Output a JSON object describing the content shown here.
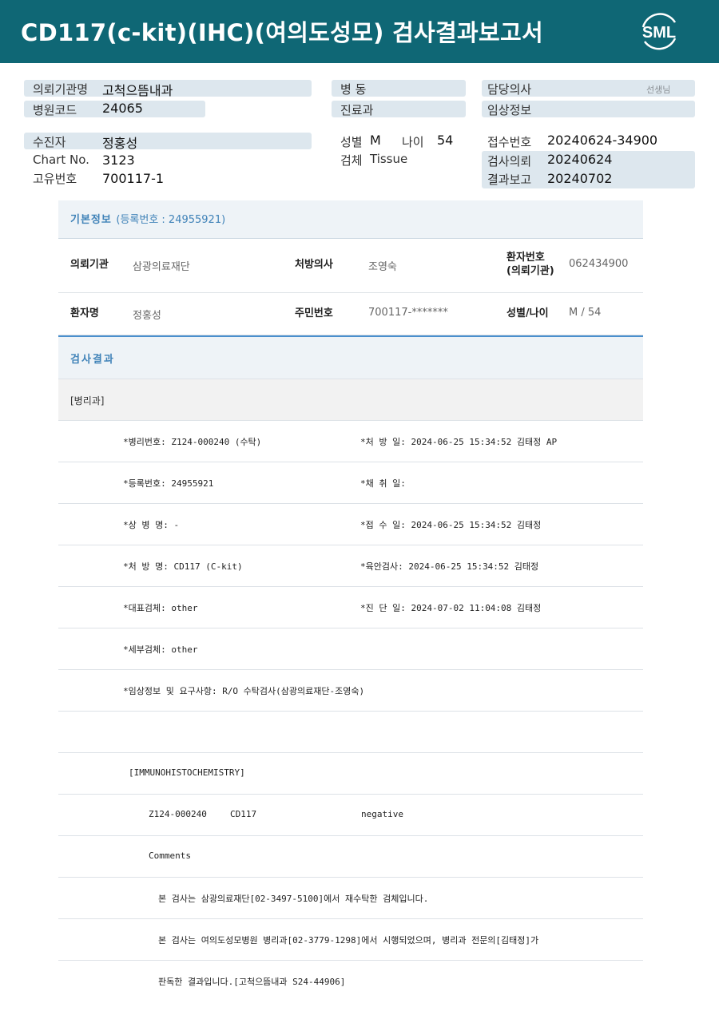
{
  "header": {
    "title": "CD117(c-kit)(IHC)(여의도성모) 검사결과보고서",
    "logo_text": "SML",
    "bg_color": "#0f6775"
  },
  "summary": {
    "institution_label": "의뢰기관명",
    "institution": "고척으뜸내과",
    "hospital_code_label": "병원코드",
    "hospital_code": "24065",
    "patient_label": "수진자",
    "patient": "정홍성",
    "chart_label": "Chart No.",
    "chart": "3123",
    "unique_label": "고유번호",
    "unique": "700117-1",
    "ward_label": "병 동",
    "dept_label": "진료과",
    "sex_label": "성별",
    "sex": "M",
    "age_label": "나이",
    "age": "54",
    "specimen_label": "검체",
    "specimen": "Tissue",
    "doctor_label": "담당의사",
    "doctor_suffix": "선생님",
    "clinical_label": "임상정보",
    "reception_label": "접수번호",
    "reception": "20240624-34900",
    "request_label": "검사의뢰",
    "request": "20240624",
    "report_label": "결과보고",
    "report": "20240702"
  },
  "basic": {
    "title": "기본정보",
    "subtitle": "(등록번호 : 24955921)",
    "rows": [
      {
        "k1": "의뢰기관",
        "v1": "삼광의료재단",
        "k2": "처방의사",
        "v2": "조영숙",
        "k3a": "환자번호",
        "k3b": "(의뢰기관)",
        "v3": "062434900"
      },
      {
        "k1": "환자명",
        "v1": "정홍성",
        "k2": "주민번호",
        "v2": "700117-*******",
        "k3": "성별/나이",
        "v3": "M / 54"
      }
    ]
  },
  "result": {
    "title": "검사결과",
    "dept": "[병리과]",
    "lines": [
      {
        "a": "*병리번호: Z124-000240 (수탁)",
        "b": "*처 방 일: 2024-06-25 15:34:52  김태정 AP"
      },
      {
        "a": "*등록번호: 24955921",
        "b": "*채 취 일:"
      },
      {
        "a": "*상 병 명: -",
        "b": "*접 수 일: 2024-06-25 15:34:52  김태정"
      },
      {
        "a": "*처 방 명: CD117 (C-kit)",
        "b": "*육안검사: 2024-06-25 15:34:52  김태정"
      },
      {
        "a": "*대표검체: other",
        "b": "*진 단 일: 2024-07-02 11:04:08  김태정"
      },
      {
        "a": "*세부검체: other",
        "b": ""
      },
      {
        "a": "*임상정보 및 요구사항: R/O 수탁검사(삼광의료재단-조영숙)",
        "b": ""
      }
    ],
    "ihc_header": "[IMMUNOHISTOCHEMISTRY]",
    "ihc_row": {
      "id": "Z124-000240",
      "marker": "CD117",
      "result": "negative"
    },
    "comments_label": "Comments",
    "comments": [
      "본 검사는 삼광의료재단[02-3497-5100]에서 재수탁한 검체입니다.",
      "본 검사는 여의도성모병원 병리과[02-3779-1298]에서 시행되었으며, 병리과 전문의[김태정]가",
      "판독한 결과입니다.[고척으뜸내과 S24-44906]"
    ]
  }
}
